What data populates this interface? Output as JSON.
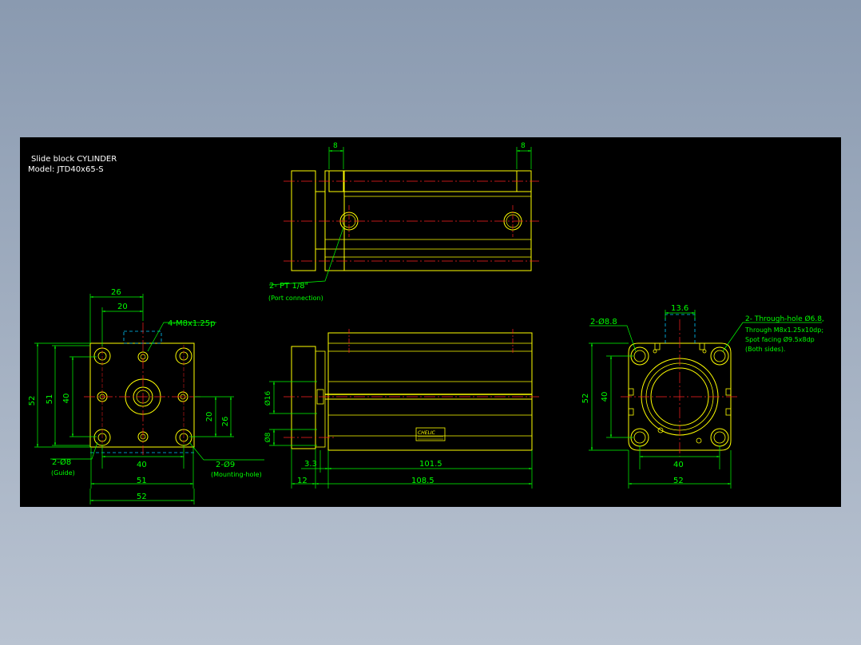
{
  "title": {
    "line1": "Slide block CYLINDER",
    "line2": "Model: JTD40x65-S"
  },
  "colors": {
    "background": "#000000",
    "outline": "#ffff00",
    "centerline": "#ff2020",
    "dimension": "#00ff00",
    "hidden": "#00c8ff",
    "text": "#ffffff",
    "page_bg": "#97a4b8"
  },
  "top_view": {
    "dim_left": "8",
    "dim_right": "8",
    "port_label": "2- PT 1/8\"",
    "port_note": "(Port connection)"
  },
  "left_view": {
    "dim_26_top": "26",
    "dim_20_top": "20",
    "thread_label": "4-M8x1.25p",
    "dim_52_v": "52",
    "dim_51_v": "51",
    "dim_40_v": "40",
    "dim_20_v": "20",
    "dim_26_v": "26",
    "guide_label": "2-Ø8",
    "guide_note": "(Guide)",
    "mount_label": "2-Ø9",
    "mount_note": "(Mounting-hole)",
    "dim_40_h": "40",
    "dim_51_h": "51",
    "dim_52_h": "52"
  },
  "front_view": {
    "dim_phi16": "Ø16",
    "dim_phi8": "Ø8",
    "dim_3_3": "3.3",
    "dim_101_5": "101.5",
    "dim_12": "12",
    "dim_108_5": "108.5",
    "nameplate": "CHELIC"
  },
  "right_view": {
    "dim_13_6": "13.6",
    "hole_label": "2-Ø8.8",
    "through_line1": "2- Through-hole Ø6.8,",
    "through_line2": "Through M8x1.25x10dp;",
    "through_line3": "Spot facing Ø9.5x8dp",
    "through_line4": "(Both sides).",
    "dim_52_v": "52",
    "dim_40_v": "40",
    "dim_40_h": "40",
    "dim_52_h": "52"
  }
}
